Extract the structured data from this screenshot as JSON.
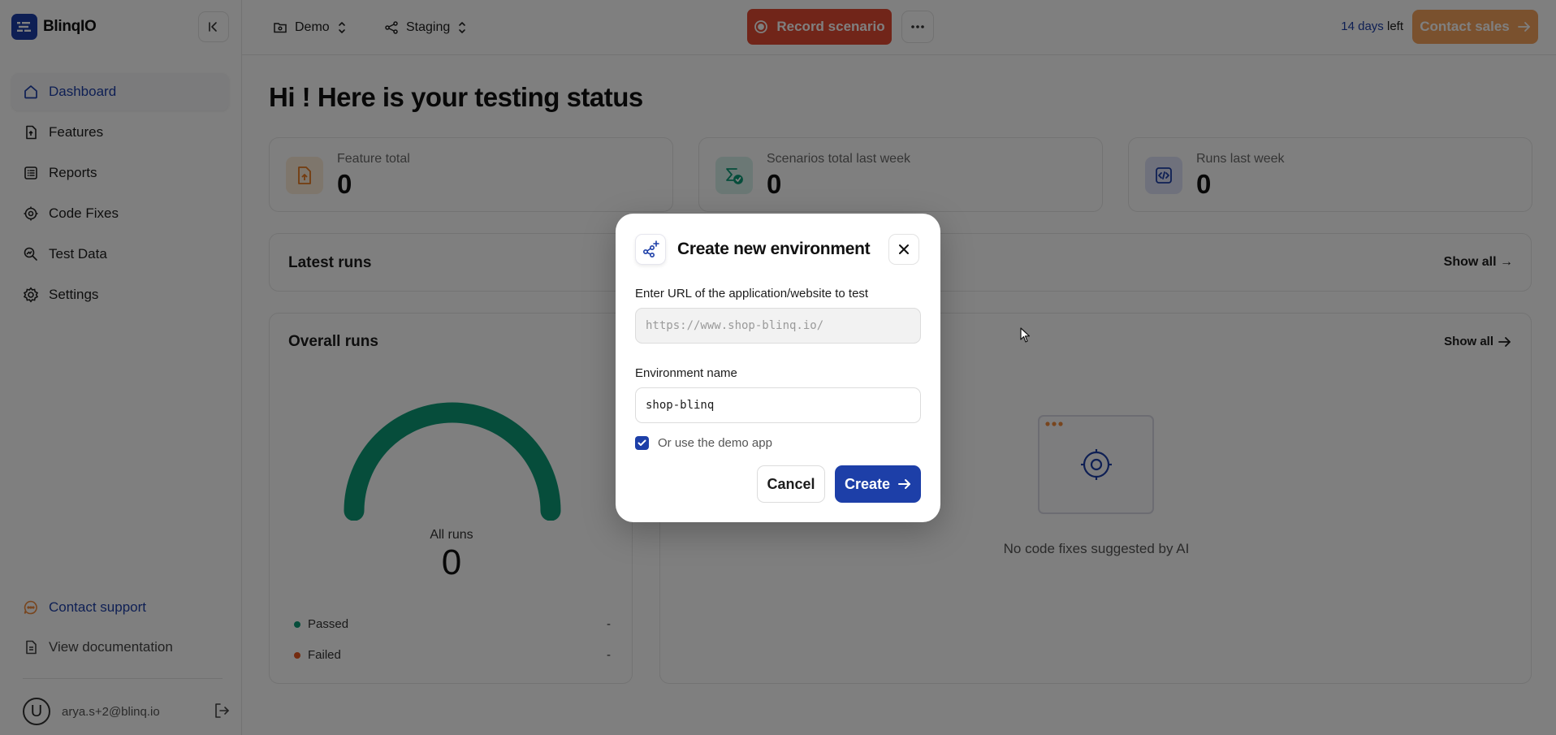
{
  "brand": {
    "name": "BlinqIO",
    "color": "#1d3fa8"
  },
  "sidebar": {
    "items": [
      {
        "label": "Dashboard",
        "icon": "home-icon",
        "active": true
      },
      {
        "label": "Features",
        "icon": "file-icon",
        "active": false
      },
      {
        "label": "Reports",
        "icon": "list-icon",
        "active": false
      },
      {
        "label": "Code Fixes",
        "icon": "gear-code-icon",
        "active": false
      },
      {
        "label": "Test Data",
        "icon": "search-data-icon",
        "active": false
      },
      {
        "label": "Settings",
        "icon": "gear-icon",
        "active": false
      }
    ],
    "contact_support": "Contact support",
    "view_documentation": "View documentation",
    "user_initial": "U",
    "user_email": "arya.s+2@blinq.io"
  },
  "topbar": {
    "project": "Demo",
    "environment": "Staging",
    "record_label": "Record scenario",
    "trial_days": "14 days",
    "trial_suffix": "left",
    "contact_sales": "Contact sales",
    "record_color": "#e34a33",
    "contact_color": "#f5a25c"
  },
  "main": {
    "greeting": "Hi ! Here is your testing status",
    "stats": [
      {
        "label": "Feature total",
        "value": "0"
      },
      {
        "label": "Scenarios total last week",
        "value": "0"
      },
      {
        "label": "Runs last week",
        "value": "0"
      }
    ],
    "latest_runs": {
      "title": "Latest runs",
      "show_all": "Show all →"
    },
    "overall_runs": {
      "title": "Overall runs",
      "center_label": "All runs",
      "center_value": "0",
      "legend": [
        {
          "label": "Passed",
          "value": "-",
          "color": "#0c9a77"
        },
        {
          "label": "Failed",
          "value": "-",
          "color": "#e8561f"
        }
      ],
      "gauge_color": "#0c9a77"
    },
    "code_fixes": {
      "show_all": "Show all",
      "empty_text": "No code fixes suggested by AI"
    }
  },
  "modal": {
    "title": "Create new environment",
    "url_label": "Enter URL of the application/website to test",
    "url_placeholder": "https://www.shop-blinq.io/",
    "name_label": "Environment name",
    "name_value": "shop-blinq",
    "demo_label": "Or use the demo app",
    "demo_checked": true,
    "cancel": "Cancel",
    "create": "Create"
  }
}
